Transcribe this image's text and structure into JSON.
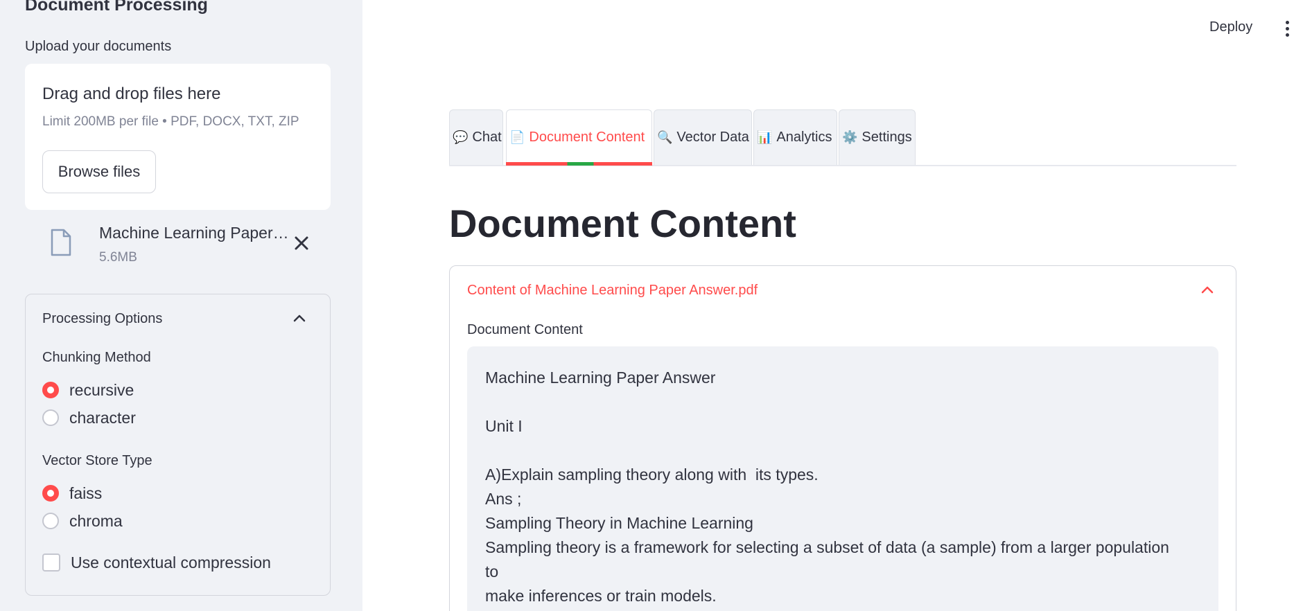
{
  "sidebar": {
    "title": "Document Processing",
    "upload_label": "Upload your documents",
    "dropzone": {
      "title": "Drag and drop files here",
      "hint": "Limit 200MB per file • PDF, DOCX, TXT, ZIP",
      "browse_label": "Browse files"
    },
    "file": {
      "name": "Machine Learning Paper Answer.pdf",
      "size": "5.6MB"
    },
    "options": {
      "header": "Processing Options",
      "chunking_label": "Chunking Method",
      "chunking_options": [
        "recursive",
        "character"
      ],
      "chunking_selected": "recursive",
      "vector_label": "Vector Store Type",
      "vector_options": [
        "faiss",
        "chroma"
      ],
      "vector_selected": "faiss",
      "compression_label": "Use contextual compression",
      "compression_checked": false
    }
  },
  "header": {
    "deploy_label": "Deploy"
  },
  "tabs": [
    {
      "icon": "💬",
      "icon_name": "speech-bubble-icon",
      "label": "Chat"
    },
    {
      "icon": "📄",
      "icon_name": "document-icon",
      "label": "Document Content"
    },
    {
      "icon": "🔍",
      "icon_name": "magnifier-icon",
      "label": "Vector Data"
    },
    {
      "icon": "📊",
      "icon_name": "bar-chart-icon",
      "label": "Analytics"
    },
    {
      "icon": "⚙️",
      "icon_name": "gear-icon",
      "label": "Settings"
    }
  ],
  "active_tab": "Document Content",
  "main": {
    "page_title": "Document Content",
    "expander_title": "Content of Machine Learning Paper Answer.pdf",
    "content_label": "Document Content",
    "content_lines": [
      "Machine Learning Paper Answer",
      "",
      "Unit I",
      "",
      "A)Explain sampling theory along with  its types.",
      "Ans ;",
      "Sampling Theory in Machine Learning",
      "Sampling theory is a framework for selecting a subset of data (a sample) from a larger population",
      "to",
      "make inferences or train models."
    ]
  },
  "colors": {
    "accent": "#ff4b4b",
    "sidebar_bg": "#f0f2f6",
    "text": "#31333f",
    "muted": "#808495"
  }
}
